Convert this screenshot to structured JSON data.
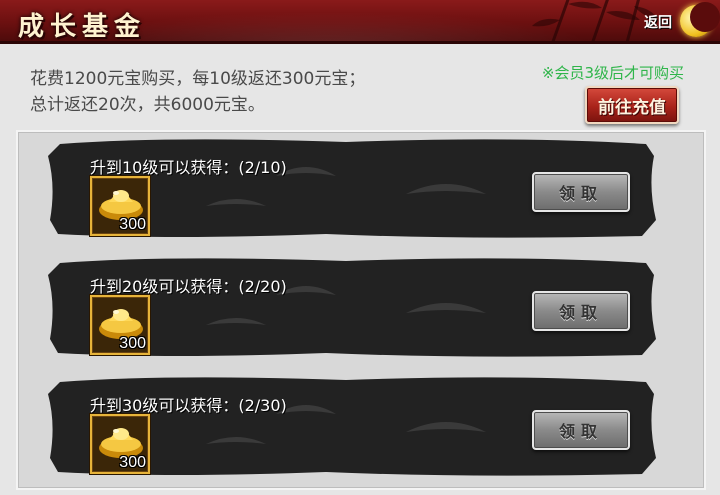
{
  "header": {
    "title": "成长基金",
    "back_label": "返回",
    "accent_color": "#6c1010"
  },
  "info": {
    "line1": "花费1200元宝购买，每10级返还300元宝；",
    "line2": "总计返还20次，共6000元宝。",
    "notice": "※会员3级后才可购买",
    "notice_color": "#2fb54a"
  },
  "recharge_button": {
    "label": "前往充值"
  },
  "rewards": [
    {
      "title": "升到10级可以获得：(2/10)",
      "item_icon": "gold-ingot-icon",
      "count": "300",
      "claim_label": "领取"
    },
    {
      "title": "升到20级可以获得：(2/20)",
      "item_icon": "gold-ingot-icon",
      "count": "300",
      "claim_label": "领取"
    },
    {
      "title": "升到30级可以获得：(2/30)",
      "item_icon": "gold-ingot-icon",
      "count": "300",
      "claim_label": "领取"
    }
  ]
}
